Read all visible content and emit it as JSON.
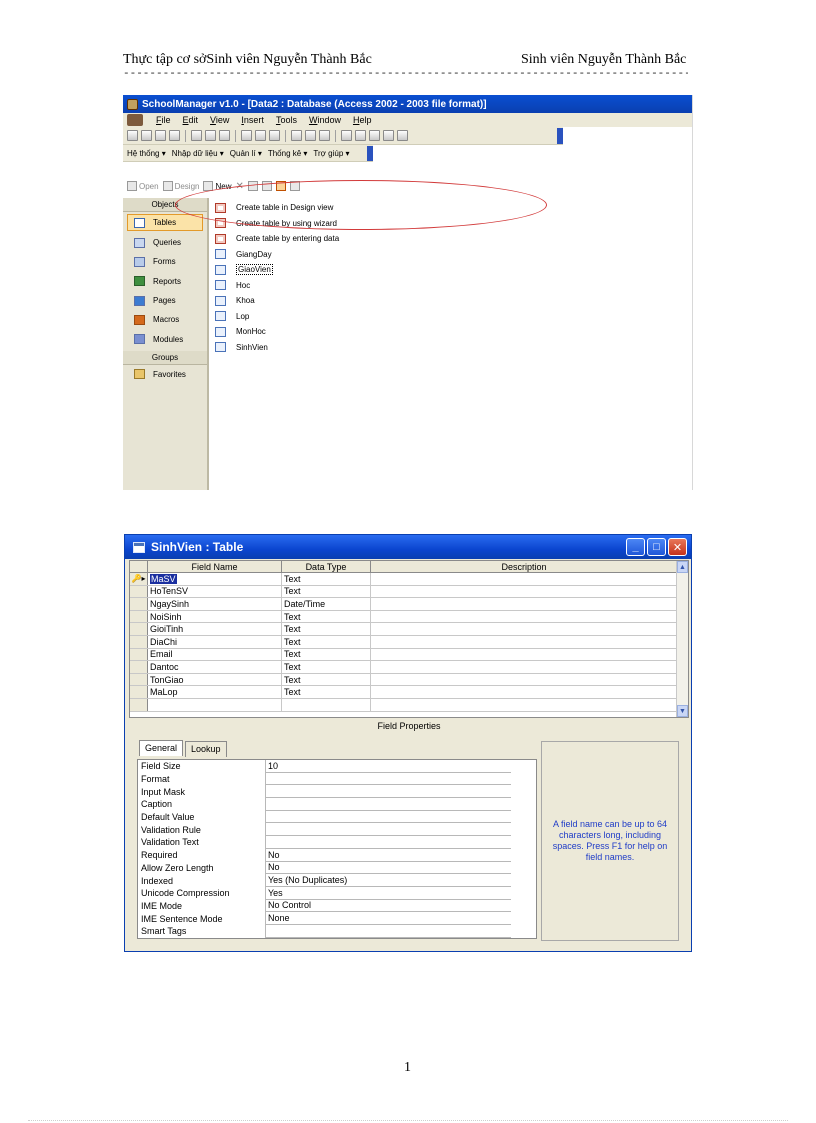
{
  "header": {
    "left": "Thực tập cơ sởSinh viên Nguyễn Thành Bắc",
    "right": "Sinh viên Nguyễn Thành Bắc",
    "rule": "----------------------------------------------------------------------------------------------------------"
  },
  "screenshot1": {
    "title": "SchoolManager v1.0 - [Data2 : Database (Access 2002 - 2003 file format)]",
    "menu": [
      "File",
      "Edit",
      "View",
      "Insert",
      "Tools",
      "Window",
      "Help"
    ],
    "custom_menu": [
      "Hệ thống ▾",
      "Nhập dữ liệu ▾",
      "Quản lí ▾",
      "Thống kê ▾",
      "Trợ giúp ▾"
    ],
    "db_toolbar": {
      "open": "Open",
      "design": "Design",
      "new": "New"
    },
    "objects_header": "Objects",
    "objects": [
      {
        "label": "Tables",
        "icon": "table-icon"
      },
      {
        "label": "Queries",
        "icon": "query-icon"
      },
      {
        "label": "Forms",
        "icon": "form-icon"
      },
      {
        "label": "Reports",
        "icon": "report-icon"
      },
      {
        "label": "Pages",
        "icon": "page-icon"
      },
      {
        "label": "Macros",
        "icon": "macro-icon"
      },
      {
        "label": "Modules",
        "icon": "module-icon"
      }
    ],
    "groups_header": "Groups",
    "favorites": "Favorites",
    "list": [
      "Create table in Design view",
      "Create table by using wizard",
      "Create table by entering data",
      "GiangDay",
      "GiaoVien",
      "Hoc",
      "Khoa",
      "Lop",
      "MonHoc",
      "SinhVien"
    ],
    "highlight_color": "#d23a3a"
  },
  "screenshot2": {
    "title": "SinhVien : Table",
    "columns": {
      "field_name": "Field Name",
      "data_type": "Data Type",
      "description": "Description"
    },
    "fields": [
      {
        "name": "MaSV",
        "type": "Text"
      },
      {
        "name": "HoTenSV",
        "type": "Text"
      },
      {
        "name": "NgaySinh",
        "type": "Date/Time"
      },
      {
        "name": "NoiSinh",
        "type": "Text"
      },
      {
        "name": "GioiTinh",
        "type": "Text"
      },
      {
        "name": "DiaChi",
        "type": "Text"
      },
      {
        "name": "Email",
        "type": "Text"
      },
      {
        "name": "Dantoc",
        "type": "Text"
      },
      {
        "name": "TonGiao",
        "type": "Text"
      },
      {
        "name": "MaLop",
        "type": "Text"
      }
    ],
    "field_properties_label": "Field Properties",
    "tabs": {
      "general": "General",
      "lookup": "Lookup"
    },
    "properties": [
      {
        "label": "Field Size",
        "value": "10"
      },
      {
        "label": "Format",
        "value": ""
      },
      {
        "label": "Input Mask",
        "value": ""
      },
      {
        "label": "Caption",
        "value": ""
      },
      {
        "label": "Default Value",
        "value": ""
      },
      {
        "label": "Validation Rule",
        "value": ""
      },
      {
        "label": "Validation Text",
        "value": ""
      },
      {
        "label": "Required",
        "value": "No"
      },
      {
        "label": "Allow Zero Length",
        "value": "No"
      },
      {
        "label": "Indexed",
        "value": "Yes (No Duplicates)"
      },
      {
        "label": "Unicode Compression",
        "value": "Yes"
      },
      {
        "label": "IME Mode",
        "value": "No Control"
      },
      {
        "label": "IME Sentence Mode",
        "value": "None"
      },
      {
        "label": "Smart Tags",
        "value": ""
      }
    ],
    "help_text": "A field name can be up to 64 characters long, including spaces. Press F1 for help on field names.",
    "help_color": "#1f3cc7"
  },
  "page_number": "1"
}
